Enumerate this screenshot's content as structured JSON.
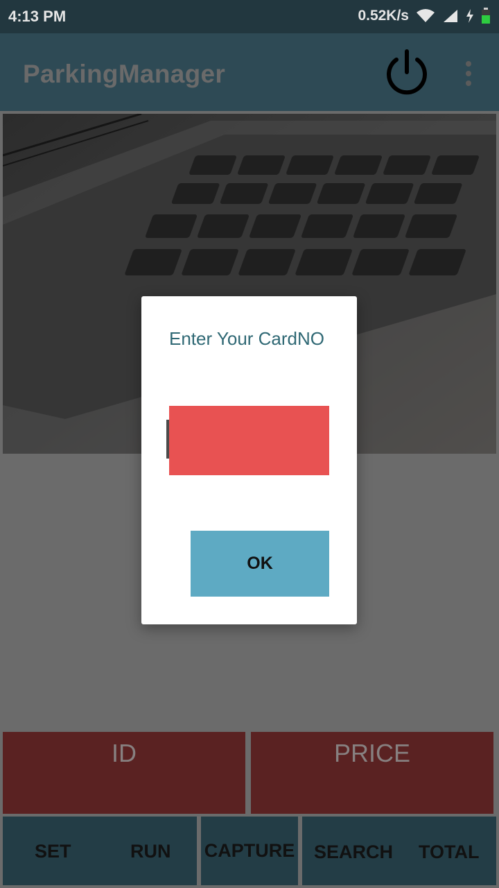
{
  "status_bar": {
    "time": "4:13 PM",
    "network_speed": "0.52K/s",
    "icons": [
      "wifi-icon",
      "signal-icon",
      "charging-icon",
      "battery-icon"
    ]
  },
  "app_bar": {
    "title": "ParkingManager",
    "icons": [
      "power-icon",
      "more-vert-icon"
    ]
  },
  "table": {
    "id_header": "ID",
    "price_header": "PRICE"
  },
  "nav": {
    "set": "SET",
    "run": "RUN",
    "capture": "CAPTURE",
    "search": "SEARCH",
    "total": "TOTAL"
  },
  "dialog": {
    "title": "Enter Your CardNO",
    "card_value": "",
    "ok_label": "OK"
  },
  "colors": {
    "status_bar": "#22373f",
    "app_bar": "#2e4a55",
    "table_cell": "#5a2222",
    "nav_button": "#233d46",
    "dialog_title": "#2f6874",
    "input_bg": "#e85252",
    "ok_button": "#5eaac3"
  }
}
